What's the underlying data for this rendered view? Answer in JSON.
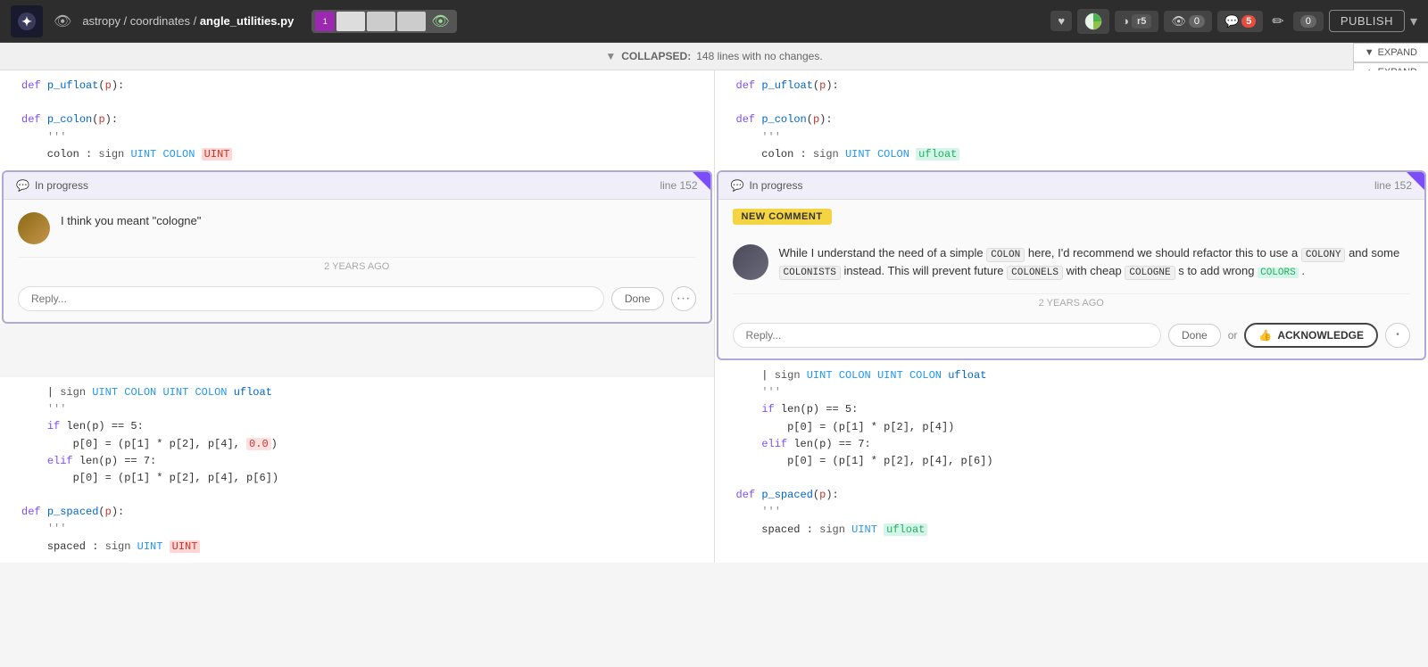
{
  "topnav": {
    "logo_symbol": "✦",
    "eye_icon": "👁",
    "breadcrumb": "astropy / coordinates / ",
    "filename": "angle_utilities.py",
    "publish_label": "PUBLISH",
    "expand_label": "EXPAND"
  },
  "collapsed_bar": {
    "label": "COLLAPSED:",
    "detail": "148 lines with no changes."
  },
  "left_pane": {
    "code_before_comment": [
      "def p_ufloat(p):",
      "",
      "def p_colon(p):",
      "    '''",
      "    colon : sign UINT COLON UINT"
    ],
    "comment": {
      "status": "In progress",
      "line": "line 152",
      "text": "I think you meant \"cologne\"",
      "timestamp": "2 YEARS AGO",
      "reply_placeholder": "Reply...",
      "done_label": "Done"
    },
    "code_after_comment": [
      "    | sign UINT COLON UINT COLON ufloat",
      "    '''",
      "    if len(p) == 5:",
      "        p[0] = (p[1] * p[2], p[4], 0.0)",
      "    elif len(p) == 7:",
      "        p[0] = (p[1] * p[2], p[4], p[6])",
      "",
      "def p_spaced(p):",
      "    '''",
      "    spaced : sign UINT UINT"
    ]
  },
  "right_pane": {
    "code_before_comment": [
      "def p_ufloat(p):",
      "",
      "def p_colon(p):",
      "    '''",
      "    colon : sign UINT COLON ufloat"
    ],
    "comment": {
      "status": "In progress",
      "line": "line 152",
      "new_comment_badge": "NEW COMMENT",
      "text_parts": {
        "intro": "While I understand the need of a simple",
        "colon": "COLON",
        "mid1": " here, I'd recommend we should refactor this to use a",
        "colony": "COLONY",
        "mid2": " and some",
        "colonists": "COLONISTS",
        "mid3": " instead. This will prevent future",
        "colonels": "COLONELS",
        "mid4": " with cheap",
        "cologne": "COLOGNE",
        "mid5": "s to add wrong",
        "colors": "COLORS",
        "end": "."
      },
      "timestamp": "2 YEARS AGO",
      "reply_placeholder": "Reply...",
      "done_label": "Done",
      "or_label": "or",
      "acknowledge_label": "ACKNOWLEDGE"
    },
    "code_after_comment": [
      "    | sign UINT COLON UINT COLON ufloat",
      "    '''",
      "    if len(p) == 5:",
      "        p[0] = (p[1] * p[2], p[4])",
      "    elif len(p) == 7:",
      "        p[0] = (p[1] * p[2], p[4], p[6])",
      "",
      "def p_spaced(p):",
      "    '''",
      "    spaced : sign UINT ufloat"
    ]
  }
}
